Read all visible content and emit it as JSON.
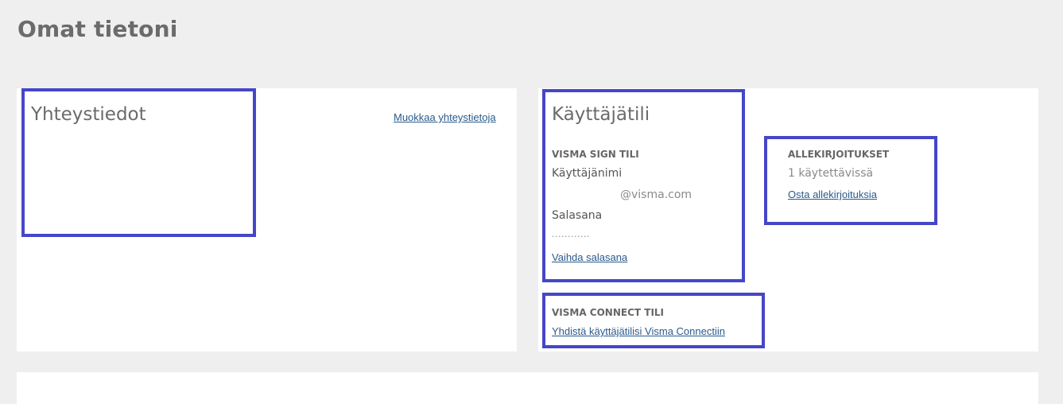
{
  "page": {
    "title": "Omat tietoni"
  },
  "contact": {
    "title": "Yhteystiedot",
    "edit_link": "Muokkaa yhteystietoja"
  },
  "account": {
    "title": "Käyttäjätili",
    "visma_sign": {
      "section_label": "VISMA SIGN TILI",
      "username_label": "Käyttäjänimi",
      "username_value": "@visma.com",
      "password_label": "Salasana",
      "password_value": "............",
      "change_password_link": "Vaihda salasana"
    },
    "signatures": {
      "section_label": "ALLEKIRJOITUKSET",
      "available": "1 käytettävissä",
      "buy_link": "Osta allekirjoituksia"
    },
    "visma_connect": {
      "section_label": "VISMA CONNECT TILI",
      "connect_link": "Yhdistä käyttäjätilisi Visma Connectiin"
    }
  },
  "colors": {
    "background": "#efefef",
    "card": "#ffffff",
    "highlight_border": "#4646c8",
    "link": "#2a5a8c"
  }
}
